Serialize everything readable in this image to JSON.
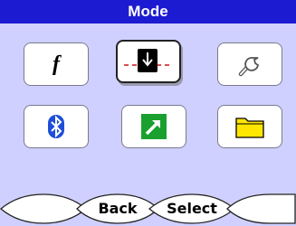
{
  "header": {
    "title": "Mode"
  },
  "modes": [
    {
      "icon": "function-icon",
      "text": "f",
      "selected": false
    },
    {
      "icon": "mode-arrow-icon",
      "selected": true
    },
    {
      "icon": "wrench-icon",
      "selected": false
    },
    {
      "icon": "bluetooth-icon",
      "selected": false
    },
    {
      "icon": "export-arrow-icon",
      "selected": false
    },
    {
      "icon": "folder-icon",
      "selected": false
    }
  ],
  "softkeys": {
    "left": "",
    "back": "Back",
    "select": "Select",
    "right": ""
  },
  "colors": {
    "title_bar": "#1d1bd1",
    "screen_bg": "#cfd0ff",
    "bluetooth": "#1f4fd8",
    "export_green": "#19a02f",
    "folder_yellow": "#ffe600",
    "selected_red": "#d01010"
  }
}
